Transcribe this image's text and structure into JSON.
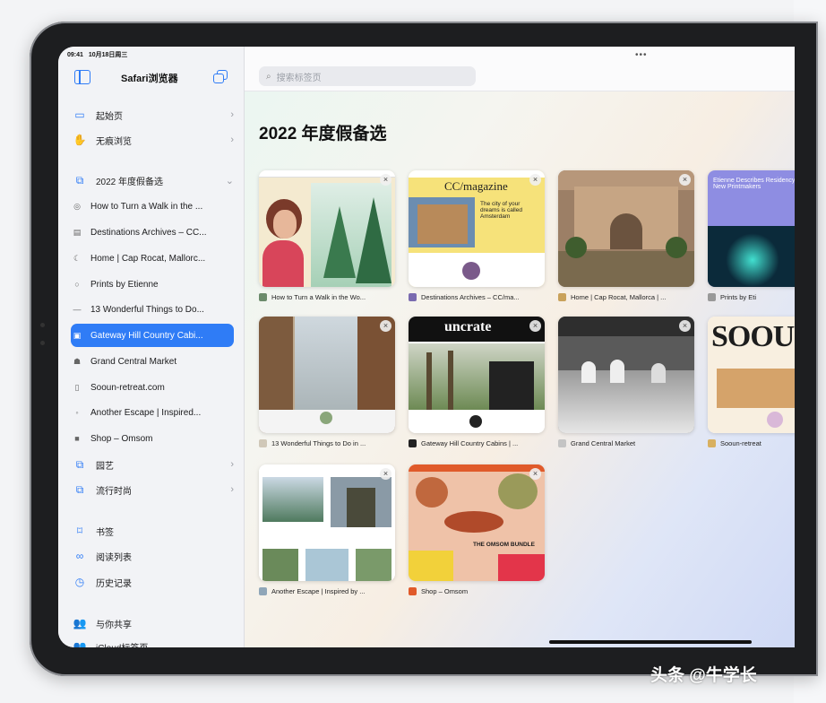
{
  "status": {
    "time": "09:41",
    "date": "10月18日周三"
  },
  "sidebar": {
    "title": "Safari浏览器",
    "icons": {
      "toggle": "sidebar-icon",
      "tabs": "tab-overview-icon"
    },
    "nav": [
      {
        "label": "起始页",
        "icon": "▭"
      },
      {
        "label": "无痕浏览",
        "icon": "✋"
      }
    ],
    "group": {
      "label": "2022 年度假备选",
      "icon": "⧉"
    },
    "tabs": [
      {
        "label": "How to Turn a Walk in the ...",
        "fav": "◎"
      },
      {
        "label": "Destinations Archives – CC...",
        "fav": "▤"
      },
      {
        "label": "Home | Cap Rocat, Mallorc...",
        "fav": "☾"
      },
      {
        "label": "Prints by Etienne",
        "fav": "○"
      },
      {
        "label": "13 Wonderful Things to Do...",
        "fav": "—"
      },
      {
        "label": "Gateway Hill Country Cabi...",
        "fav": "▣"
      },
      {
        "label": "Grand Central Market",
        "fav": "☗"
      },
      {
        "label": "Sooun-retreat.com",
        "fav": "▯"
      },
      {
        "label": "Another Escape | Inspired...",
        "fav": "◦"
      },
      {
        "label": "Shop – Omsom",
        "fav": "■"
      }
    ],
    "groups2": [
      {
        "label": "园艺",
        "icon": "⧉"
      },
      {
        "label": "流行时尚",
        "icon": "⧉"
      }
    ],
    "library": [
      {
        "label": "书签",
        "icon": "⌑"
      },
      {
        "label": "阅读列表",
        "icon": "∞"
      },
      {
        "label": "历史记录",
        "icon": "◷"
      },
      {
        "label": "与你共享",
        "icon": "👥"
      }
    ],
    "cut_item": "iCloud标签页"
  },
  "main": {
    "search_placeholder": "搜索标签页",
    "heading": "2022 年度假备选",
    "cards": [
      {
        "caption": "How to Turn a Walk in the Wo...",
        "favcolor": "#6b8b6b"
      },
      {
        "caption": "Destinations Archives – CC/ma...",
        "favcolor": "#7a6bb0"
      },
      {
        "caption": "Home | Cap Rocat, Mallorca | ...",
        "favcolor": "#c9a25b"
      },
      {
        "caption": "Prints by Eti",
        "favcolor": "#999999"
      },
      {
        "caption": "13 Wonderful Things to Do in ...",
        "favcolor": "#d0c8b8"
      },
      {
        "caption": "Gateway Hill Country Cabins | ...",
        "favcolor": "#222222"
      },
      {
        "caption": "Grand Central Market",
        "favcolor": "#c4c4c4"
      },
      {
        "caption": "Sooun-retreat",
        "favcolor": "#d8b060"
      },
      {
        "caption": "Another Escape | Inspired by ...",
        "favcolor": "#8fa6b8"
      },
      {
        "caption": "Shop – Omsom",
        "favcolor": "#e05a2a"
      }
    ],
    "thumb_text": {
      "cc": "CC/magazine",
      "cc_sub": "The city of your dreams is called Amsterdam",
      "etienne": "Etienne Describes Residency for New Printmakers",
      "uncrate": "uncrate",
      "sooun": "SOOU",
      "omsom": "THE OMSOM BUNDLE"
    }
  },
  "watermark": "头条 @牛学长"
}
